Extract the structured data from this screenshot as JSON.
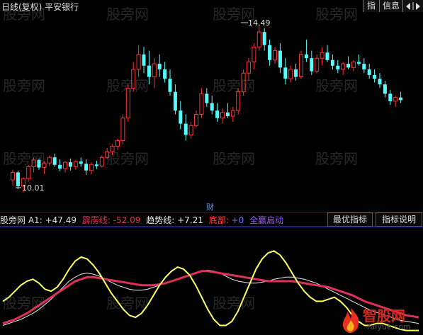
{
  "window": {
    "title": "日线(复权)  平安银行",
    "buttons": [
      "指",
      "信息"
    ]
  },
  "main_chart": {
    "high_label": "14.49",
    "low_label": "10.01",
    "marker": "财",
    "bull_color": "#ff3232",
    "bear_color": "#54ffff",
    "candles": [
      [
        10.35,
        10.62,
        10.2,
        10.55
      ],
      [
        10.55,
        10.6,
        10.1,
        10.18
      ],
      [
        10.18,
        10.42,
        10.01,
        10.38
      ],
      [
        10.38,
        10.75,
        10.3,
        10.7
      ],
      [
        10.7,
        10.95,
        10.55,
        10.88
      ],
      [
        10.88,
        10.92,
        10.62,
        10.68
      ],
      [
        10.68,
        10.85,
        10.5,
        10.8
      ],
      [
        10.8,
        11.0,
        10.72,
        10.95
      ],
      [
        10.95,
        11.05,
        10.7,
        10.75
      ],
      [
        10.75,
        10.9,
        10.58,
        10.65
      ],
      [
        10.65,
        10.85,
        10.55,
        10.82
      ],
      [
        10.82,
        10.92,
        10.6,
        10.7
      ],
      [
        10.7,
        10.88,
        10.62,
        10.84
      ],
      [
        10.84,
        10.95,
        10.7,
        10.78
      ],
      [
        10.78,
        10.9,
        10.48,
        10.6
      ],
      [
        10.6,
        10.82,
        10.5,
        10.76
      ],
      [
        10.76,
        10.86,
        10.64,
        10.72
      ],
      [
        10.72,
        11.0,
        10.68,
        10.95
      ],
      [
        10.95,
        11.2,
        10.9,
        11.1
      ],
      [
        11.1,
        11.3,
        11.0,
        11.25
      ],
      [
        11.25,
        11.45,
        11.15,
        11.4
      ],
      [
        11.4,
        12.1,
        11.3,
        12.0
      ],
      [
        12.0,
        12.9,
        11.9,
        12.8
      ],
      [
        12.8,
        13.5,
        12.7,
        13.3
      ],
      [
        13.3,
        13.95,
        13.1,
        13.7
      ],
      [
        13.7,
        13.9,
        13.2,
        13.4
      ],
      [
        13.4,
        13.8,
        12.9,
        13.1
      ],
      [
        13.1,
        13.6,
        12.8,
        13.45
      ],
      [
        13.45,
        13.7,
        13.1,
        13.3
      ],
      [
        13.3,
        13.5,
        12.95,
        13.05
      ],
      [
        13.05,
        13.3,
        12.6,
        12.7
      ],
      [
        12.7,
        12.9,
        12.1,
        12.2
      ],
      [
        12.2,
        12.45,
        11.7,
        11.85
      ],
      [
        11.85,
        12.1,
        11.4,
        11.55
      ],
      [
        11.55,
        11.9,
        11.45,
        11.8
      ],
      [
        11.8,
        12.2,
        11.75,
        12.1
      ],
      [
        12.1,
        12.8,
        12.0,
        12.65
      ],
      [
        12.65,
        12.8,
        12.3,
        12.4
      ],
      [
        12.4,
        12.6,
        12.1,
        12.2
      ],
      [
        12.2,
        12.4,
        11.9,
        12.0
      ],
      [
        12.0,
        12.25,
        11.85,
        12.15
      ],
      [
        12.15,
        12.4,
        12.0,
        12.05
      ],
      [
        12.05,
        12.3,
        11.9,
        12.2
      ],
      [
        12.2,
        12.8,
        12.1,
        12.7
      ],
      [
        12.7,
        13.3,
        12.6,
        13.2
      ],
      [
        13.2,
        13.6,
        13.0,
        13.5
      ],
      [
        13.5,
        14.0,
        13.3,
        13.9
      ],
      [
        13.9,
        14.49,
        13.8,
        14.3
      ],
      [
        14.3,
        14.4,
        13.8,
        13.95
      ],
      [
        13.95,
        14.1,
        13.4,
        13.55
      ],
      [
        13.55,
        13.9,
        13.45,
        13.8
      ],
      [
        13.8,
        14.0,
        13.2,
        13.35
      ],
      [
        13.35,
        13.6,
        12.9,
        13.05
      ],
      [
        13.05,
        13.4,
        12.95,
        13.3
      ],
      [
        13.3,
        13.45,
        13.0,
        13.1
      ],
      [
        13.1,
        13.8,
        13.05,
        13.7
      ],
      [
        13.7,
        14.1,
        13.5,
        13.6
      ],
      [
        13.6,
        13.8,
        13.15,
        13.25
      ],
      [
        13.25,
        13.7,
        13.2,
        13.6
      ],
      [
        13.6,
        13.9,
        13.4,
        13.75
      ],
      [
        13.75,
        13.95,
        13.5,
        13.55
      ],
      [
        13.55,
        13.7,
        13.3,
        13.4
      ],
      [
        13.4,
        13.55,
        13.2,
        13.3
      ],
      [
        13.3,
        13.5,
        13.15,
        13.45
      ],
      [
        13.45,
        13.65,
        13.3,
        13.35
      ],
      [
        13.35,
        13.55,
        13.25,
        13.5
      ],
      [
        13.5,
        13.7,
        13.4,
        13.45
      ],
      [
        13.45,
        13.6,
        13.2,
        13.3
      ],
      [
        13.3,
        13.45,
        13.05,
        13.15
      ],
      [
        13.15,
        13.3,
        12.95,
        13.05
      ],
      [
        13.05,
        13.2,
        12.8,
        12.9
      ],
      [
        12.9,
        13.0,
        12.55,
        12.65
      ],
      [
        12.65,
        12.75,
        12.35,
        12.45
      ],
      [
        12.45,
        12.6,
        12.3,
        12.55
      ],
      [
        12.55,
        12.7,
        12.4,
        12.48
      ]
    ]
  },
  "indicator": {
    "source": "股旁网",
    "a1_label": "A1:",
    "a1_value": "+47.49",
    "pili_label": "霹雳线:",
    "pili_value": "-52.09",
    "trend_label": "趋势线:",
    "trend_value": "+7.21",
    "bottom_label": "底部:",
    "bottom_value": "+0",
    "launch_label": "全赢启动",
    "btn_best": "最优指标",
    "btn_explain": "指标说明",
    "yellow_color": "#ffff66",
    "red_color": "#e0305a",
    "white_color": "#e8e8e8",
    "blue_color": "#3b3bff",
    "yellow": [
      30,
      34,
      40,
      46,
      50,
      52,
      48,
      42,
      40,
      44,
      52,
      62,
      70,
      74,
      72,
      66,
      58,
      48,
      38,
      30,
      22,
      16,
      14,
      18,
      26,
      36,
      46,
      54,
      60,
      64,
      62,
      56,
      46,
      34,
      22,
      12,
      6,
      6,
      10,
      20,
      34,
      48,
      62,
      72,
      78,
      80,
      76,
      68,
      58,
      48,
      40,
      34,
      30,
      30,
      32,
      34,
      30,
      24,
      16,
      10,
      6,
      6,
      8,
      8,
      6,
      4,
      2,
      1,
      1,
      1
    ],
    "red": [
      8,
      10,
      12,
      15,
      18,
      22,
      26,
      30,
      34,
      38,
      42,
      46,
      50,
      52,
      54,
      54,
      53,
      52,
      51,
      50,
      49,
      48,
      47,
      46,
      46,
      46,
      47,
      48,
      50,
      52,
      54,
      56,
      58,
      60,
      60,
      59,
      58,
      57,
      56,
      55,
      54,
      53,
      52,
      51,
      50,
      50,
      50,
      50,
      50,
      49,
      48,
      47,
      46,
      45,
      44,
      42,
      40,
      38,
      36,
      33,
      30,
      28,
      26,
      24,
      22,
      20,
      18,
      16,
      15,
      14
    ],
    "white": [
      6,
      8,
      10,
      12,
      15,
      18,
      22,
      27,
      32,
      38,
      44,
      50,
      54,
      57,
      58,
      57,
      55,
      52,
      49,
      46,
      44,
      42,
      41,
      41,
      42,
      44,
      46,
      48,
      50,
      52,
      54,
      56,
      58,
      60,
      61,
      60,
      58,
      55,
      52,
      50,
      49,
      48,
      48,
      49,
      50,
      52,
      53,
      54,
      54,
      53,
      52,
      50,
      48,
      45,
      42,
      39,
      36,
      33,
      30,
      27,
      24,
      21,
      19,
      17,
      15,
      13,
      11,
      10,
      9,
      8
    ]
  },
  "watermark": "股旁网",
  "logo": {
    "text": "智股网",
    "url_text": "raiyue.com"
  }
}
